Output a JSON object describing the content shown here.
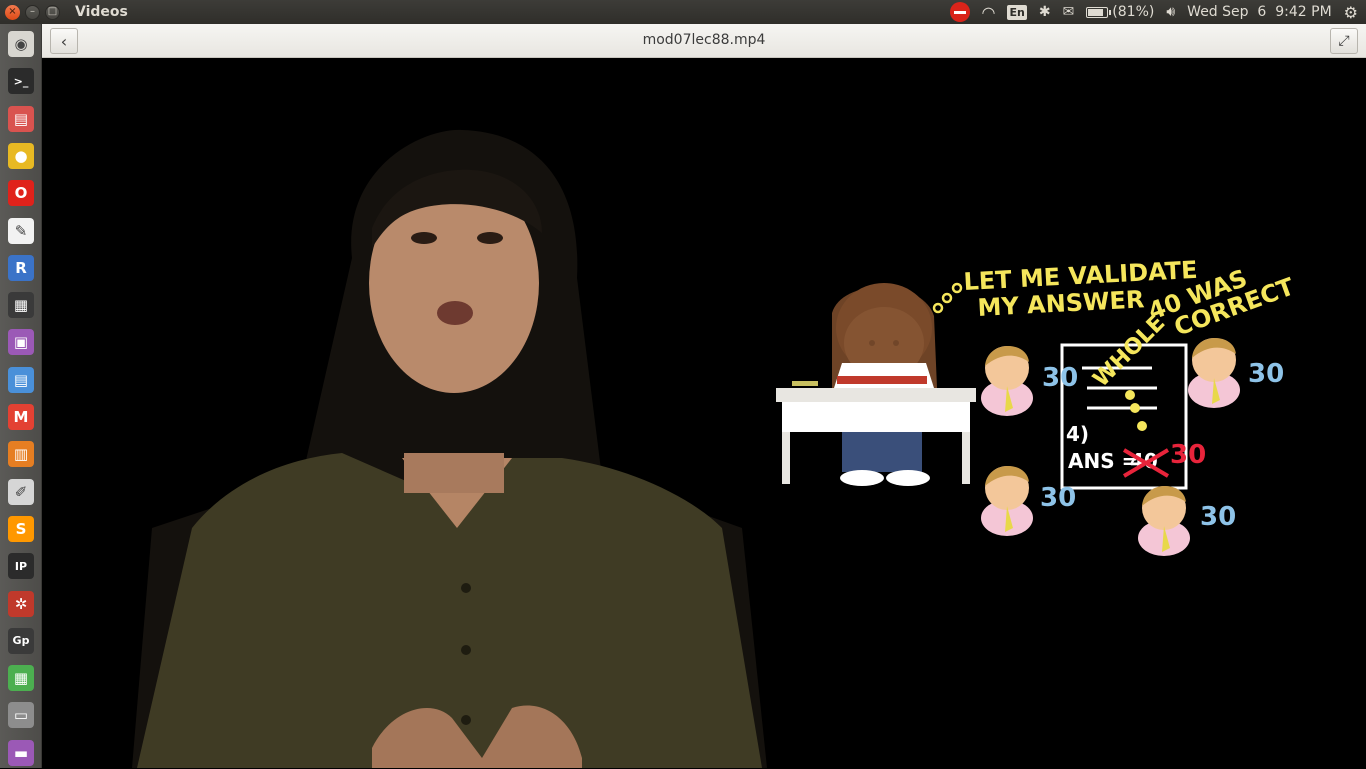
{
  "app": {
    "title": "Videos"
  },
  "panel": {
    "keyboard_layout": "En",
    "battery_percent": "(81%)",
    "battery_level": 0.81,
    "datetime": "Wed Sep  6  9:42 PM"
  },
  "player": {
    "file_name": "mod07lec88.mp4"
  },
  "launcher": {
    "items": [
      {
        "name": "dash-home",
        "glyph": "◉",
        "color": "#d8d6d0"
      },
      {
        "name": "terminal",
        "glyph": ">_",
        "color": "#2b2b2b"
      },
      {
        "name": "files",
        "glyph": "▤",
        "color": "#d9534f"
      },
      {
        "name": "chrome",
        "glyph": "●",
        "color": "#e8b923"
      },
      {
        "name": "opera",
        "glyph": "O",
        "color": "#e0221b"
      },
      {
        "name": "document-viewer",
        "glyph": "✎",
        "color": "#f2f2f2"
      },
      {
        "name": "r",
        "glyph": "R",
        "color": "#3b73c8"
      },
      {
        "name": "video-editor",
        "glyph": "▦",
        "color": "#3a3a3a"
      },
      {
        "name": "media-player",
        "glyph": "▣",
        "color": "#9b59b6"
      },
      {
        "name": "writer",
        "glyph": "▤",
        "color": "#4a90d9"
      },
      {
        "name": "gmail",
        "glyph": "M",
        "color": "#e34133"
      },
      {
        "name": "impress",
        "glyph": "▥",
        "color": "#e67e22"
      },
      {
        "name": "text-editor",
        "glyph": "✐",
        "color": "#d6d6d6"
      },
      {
        "name": "sublime",
        "glyph": "S",
        "color": "#ff9800"
      },
      {
        "name": "ipython",
        "glyph": "IP",
        "color": "#2b2b2b"
      },
      {
        "name": "settings-wheel",
        "glyph": "✲",
        "color": "#c0392b"
      },
      {
        "name": "gp",
        "glyph": "Gp",
        "color": "#3a3a3a"
      },
      {
        "name": "calc",
        "glyph": "▦",
        "color": "#4caf50"
      },
      {
        "name": "drive",
        "glyph": "▭",
        "color": "#8d8d8d"
      },
      {
        "name": "app-extra",
        "glyph": "▬",
        "color": "#9b59b6"
      }
    ]
  },
  "video_overlay": {
    "thought_text_line1": "LET ME VALIDATE",
    "thought_text_line2": "MY ANSWER",
    "whole_text": "WHOLE",
    "correct_line1": "40 WAS",
    "correct_line2": "CORRECT",
    "sheet_number": "4)",
    "sheet_answer": "ANS =",
    "crossed_value": "40",
    "new_value": "30",
    "student_scores": [
      "30",
      "30",
      "30",
      "30"
    ]
  }
}
